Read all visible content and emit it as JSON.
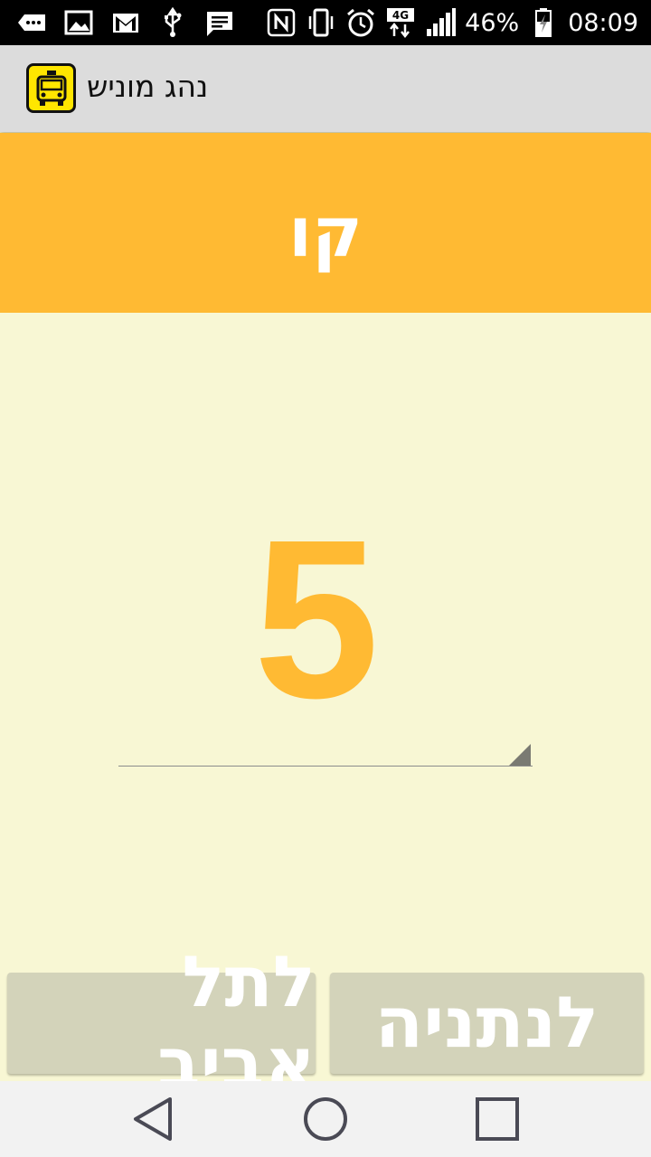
{
  "status_bar": {
    "battery_percent": "46%",
    "network": "4G",
    "time": "08:09",
    "icons_left": [
      "more-notifications-icon",
      "image-icon",
      "gmail-icon",
      "usb-icon",
      "message-icon"
    ],
    "icons_right": [
      "nfc-icon",
      "vibrate-icon",
      "alarm-icon",
      "network-4g-icon",
      "signal-icon",
      "battery-icon"
    ]
  },
  "app_bar": {
    "title": "נהג מוניש",
    "icon": "taxi-icon"
  },
  "banner": {
    "label": "קו"
  },
  "line_selector": {
    "value": "5"
  },
  "buttons": {
    "to_tel_aviv": "לתל אביב",
    "to_netanya": "לנתניה"
  },
  "nav_bar": {
    "icons": [
      "back-icon",
      "home-icon",
      "recent-apps-icon"
    ]
  },
  "colors": {
    "accent": "#ffba33",
    "background": "#f8f7d4",
    "button": "#d3d3ba",
    "app_bar": "#dcdcdc"
  }
}
